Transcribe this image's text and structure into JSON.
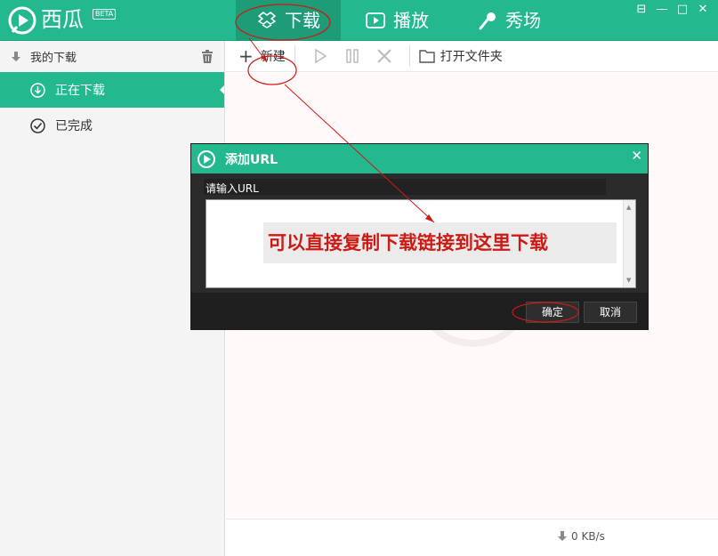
{
  "app": {
    "name": "西瓜",
    "badge": "BETA"
  },
  "nav": {
    "tabs": [
      {
        "label": "下载",
        "icon": "box-icon",
        "active": true
      },
      {
        "label": "播放",
        "icon": "play-screen-icon",
        "active": false
      },
      {
        "label": "秀场",
        "icon": "microphone-icon",
        "active": false
      }
    ]
  },
  "window_controls": [
    "menu-icon",
    "minimize-icon",
    "maximize-icon",
    "close-icon"
  ],
  "sidebar": {
    "header": "我的下载",
    "items": [
      {
        "label": "正在下载",
        "icon": "download-circle-icon",
        "active": true
      },
      {
        "label": "已完成",
        "icon": "check-circle-icon",
        "active": false
      }
    ]
  },
  "toolbar": {
    "new_label": "新建",
    "open_folder_label": "打开文件夹"
  },
  "status": {
    "speed": "0 KB/s"
  },
  "dialog": {
    "title": "添加URL",
    "prompt": "请输入URL",
    "input_value": "",
    "ok_label": "确定",
    "cancel_label": "取消"
  },
  "annotation": {
    "text": "可以直接复制下载链接到这里下载",
    "color": "#cc1b14"
  },
  "colors": {
    "brand": "#23b88d",
    "brand_dark": "#1e9b77",
    "dialog_bg": "#2b2b2b"
  }
}
